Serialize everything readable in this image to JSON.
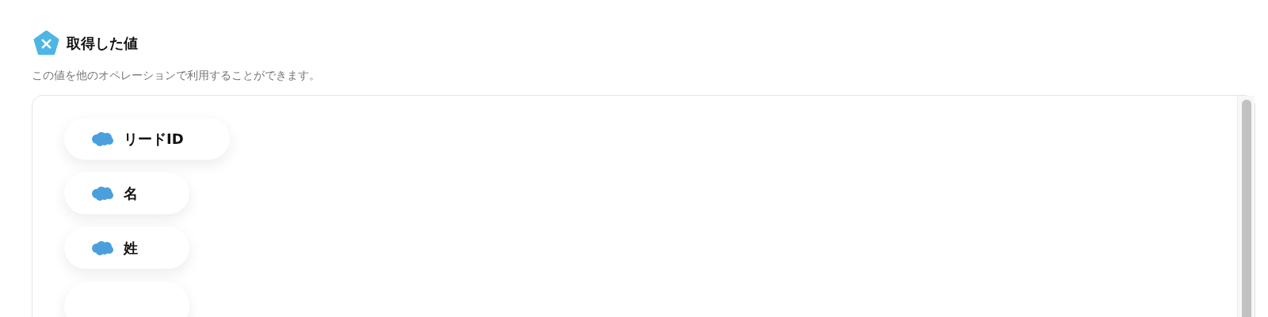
{
  "section": {
    "title": "取得した値",
    "description": "この値を他のオペレーションで利用することができます。"
  },
  "values": [
    {
      "label": "リードID"
    },
    {
      "label": "名"
    },
    {
      "label": "姓"
    }
  ]
}
